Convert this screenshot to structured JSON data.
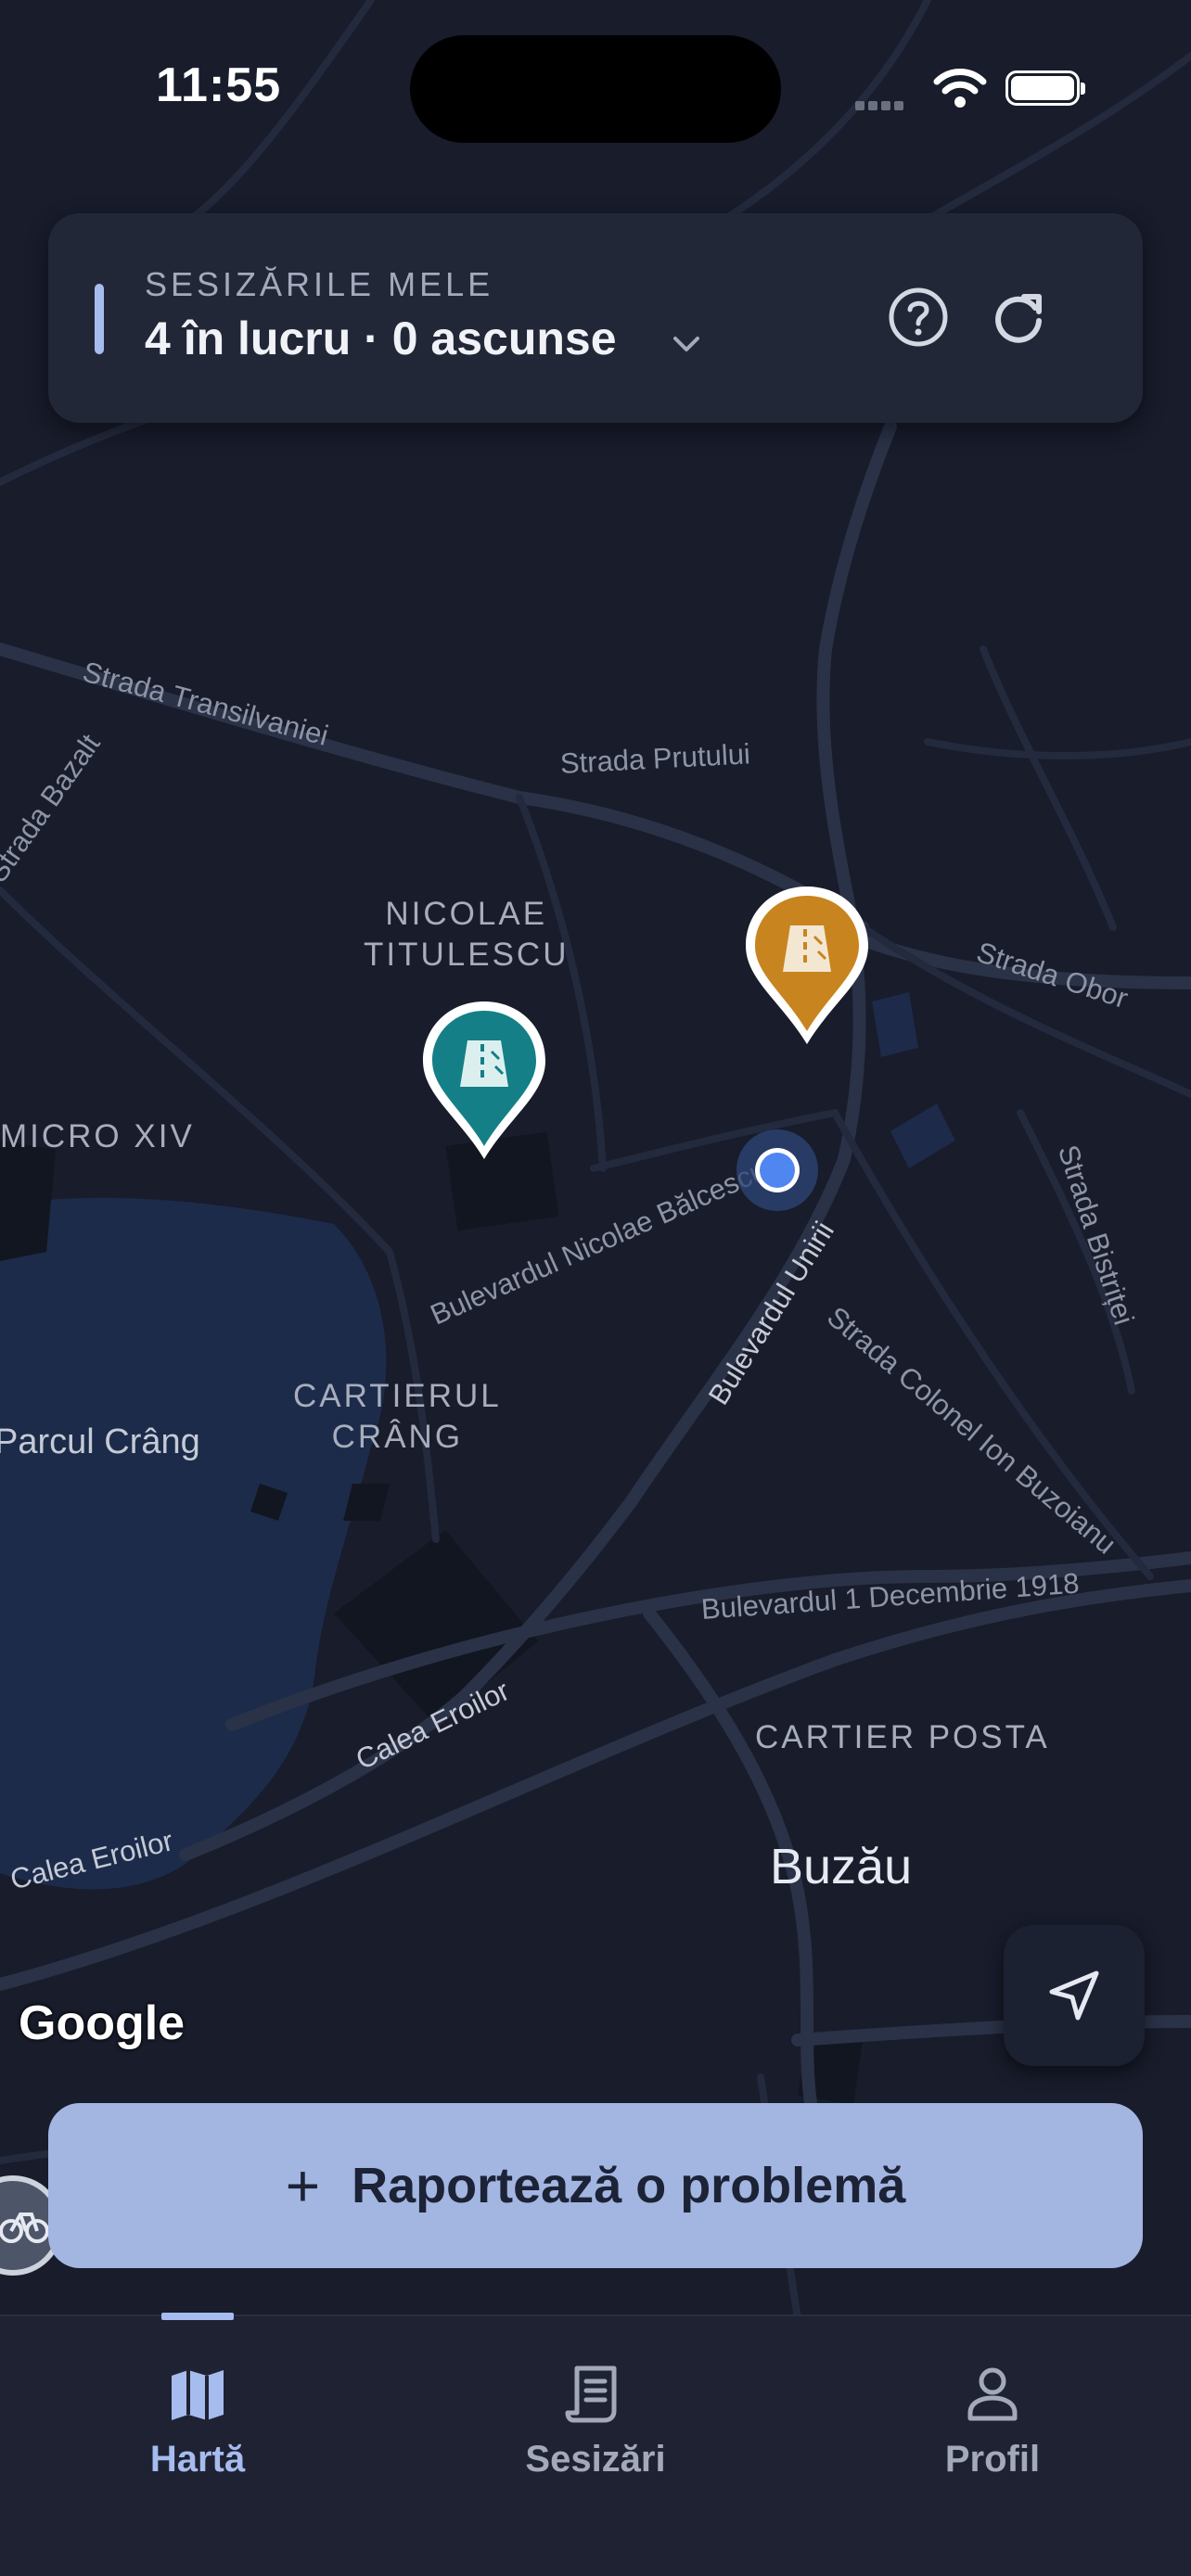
{
  "status_bar": {
    "time": "11:55"
  },
  "header_card": {
    "eyebrow": "SESIZĂRILE MELE",
    "summary": "4 în lucru · 0 ascunse",
    "help_icon": "question-circle-icon",
    "refresh_icon": "refresh-icon"
  },
  "map": {
    "streets": {
      "transilvaniei": "Strada Transilvaniei",
      "bazalt": "Strada Bazalt",
      "prutului": "Strada Prutului",
      "obor": "Strada Obor",
      "bistritei": "Strada Bistriței",
      "balcescu": "Bulevardul Nicolae Bălcescu",
      "unirii": "Bulevardul Unirii",
      "buzoianu": "Strada Colonel Ion Buzoianu",
      "decembrie": "Bulevardul 1 Decembrie 1918",
      "calea_eroilor_1": "Calea Eroilor",
      "calea_eroilor_2": "Calea Eroilor",
      "parcul": "Parcul Crâng"
    },
    "districts": {
      "titulescu": "NICOLAE\nTITULESCU",
      "micro": "MICRO XIV",
      "crang": "CARTIERUL\nCRÂNG",
      "posta": "CARTIER POSTA"
    },
    "city": "Buzău",
    "attribution": "Google",
    "pins": [
      {
        "status": "orange",
        "color": "#c8841e",
        "icon": "road-icon"
      },
      {
        "status": "teal",
        "color": "#147f86",
        "icon": "road-icon"
      }
    ]
  },
  "actions": {
    "report_label": "Raportează o problemă",
    "report_icon": "plus-icon",
    "locate_icon": "navigation-arrow-icon"
  },
  "bottom_nav": {
    "items": [
      {
        "label": "Hartă",
        "icon": "map-icon",
        "active": true
      },
      {
        "label": "Sesizări",
        "icon": "document-icon",
        "active": false
      },
      {
        "label": "Profil",
        "icon": "person-icon",
        "active": false
      }
    ]
  },
  "colors": {
    "map_background": "#181c2b",
    "accent": "#a6bbee",
    "report_button": "#a3b5e1",
    "pin_orange": "#c8841e",
    "pin_teal": "#147f86",
    "user_location": "#4f86f0"
  }
}
